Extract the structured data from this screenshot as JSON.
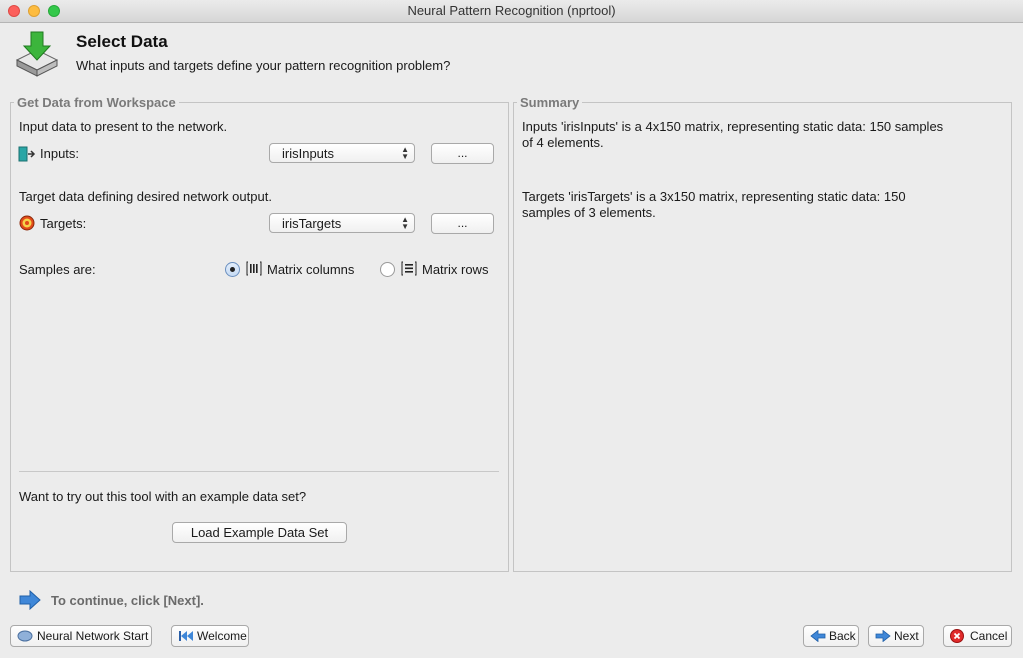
{
  "window": {
    "title": "Neural Pattern Recognition (nprtool)"
  },
  "header": {
    "title": "Select Data",
    "subtitle": "What inputs and targets define your pattern recognition problem?"
  },
  "workspace": {
    "legend": "Get Data from Workspace",
    "inputs_desc": "Input data to present to the network.",
    "inputs_label": "Inputs:",
    "inputs_value": "irisInputs",
    "inputs_browse": "...",
    "targets_desc": "Target data defining desired network output.",
    "targets_label": "Targets:",
    "targets_value": "irisTargets",
    "targets_browse": "...",
    "samples_label": "Samples are:",
    "option_columns": "Matrix columns",
    "option_rows": "Matrix rows",
    "selected_option": "Matrix columns",
    "example_prompt": "Want to try out this tool with an example data set?",
    "load_example": "Load Example Data Set"
  },
  "summary": {
    "legend": "Summary",
    "inputs_line1": "Inputs 'irisInputs' is a 4x150 matrix, representing static data: 150 samples",
    "inputs_line2": "of 4 elements.",
    "targets_line1": "Targets 'irisTargets' is a 3x150 matrix, representing static data: 150",
    "targets_line2": "samples of 3 elements."
  },
  "footer": {
    "hint": "To continue, click [Next].",
    "nn_start": "Neural Network Start",
    "welcome": "Welcome",
    "back": "Back",
    "next": "Next",
    "cancel": "Cancel"
  },
  "icons": [
    "download-tray-icon",
    "inputs-icon",
    "targets-icon",
    "matrix-columns-icon",
    "matrix-rows-icon",
    "arrow-right-icon",
    "neural-network-icon",
    "rewind-icon",
    "back-arrow-icon",
    "next-arrow-icon",
    "cancel-icon"
  ]
}
